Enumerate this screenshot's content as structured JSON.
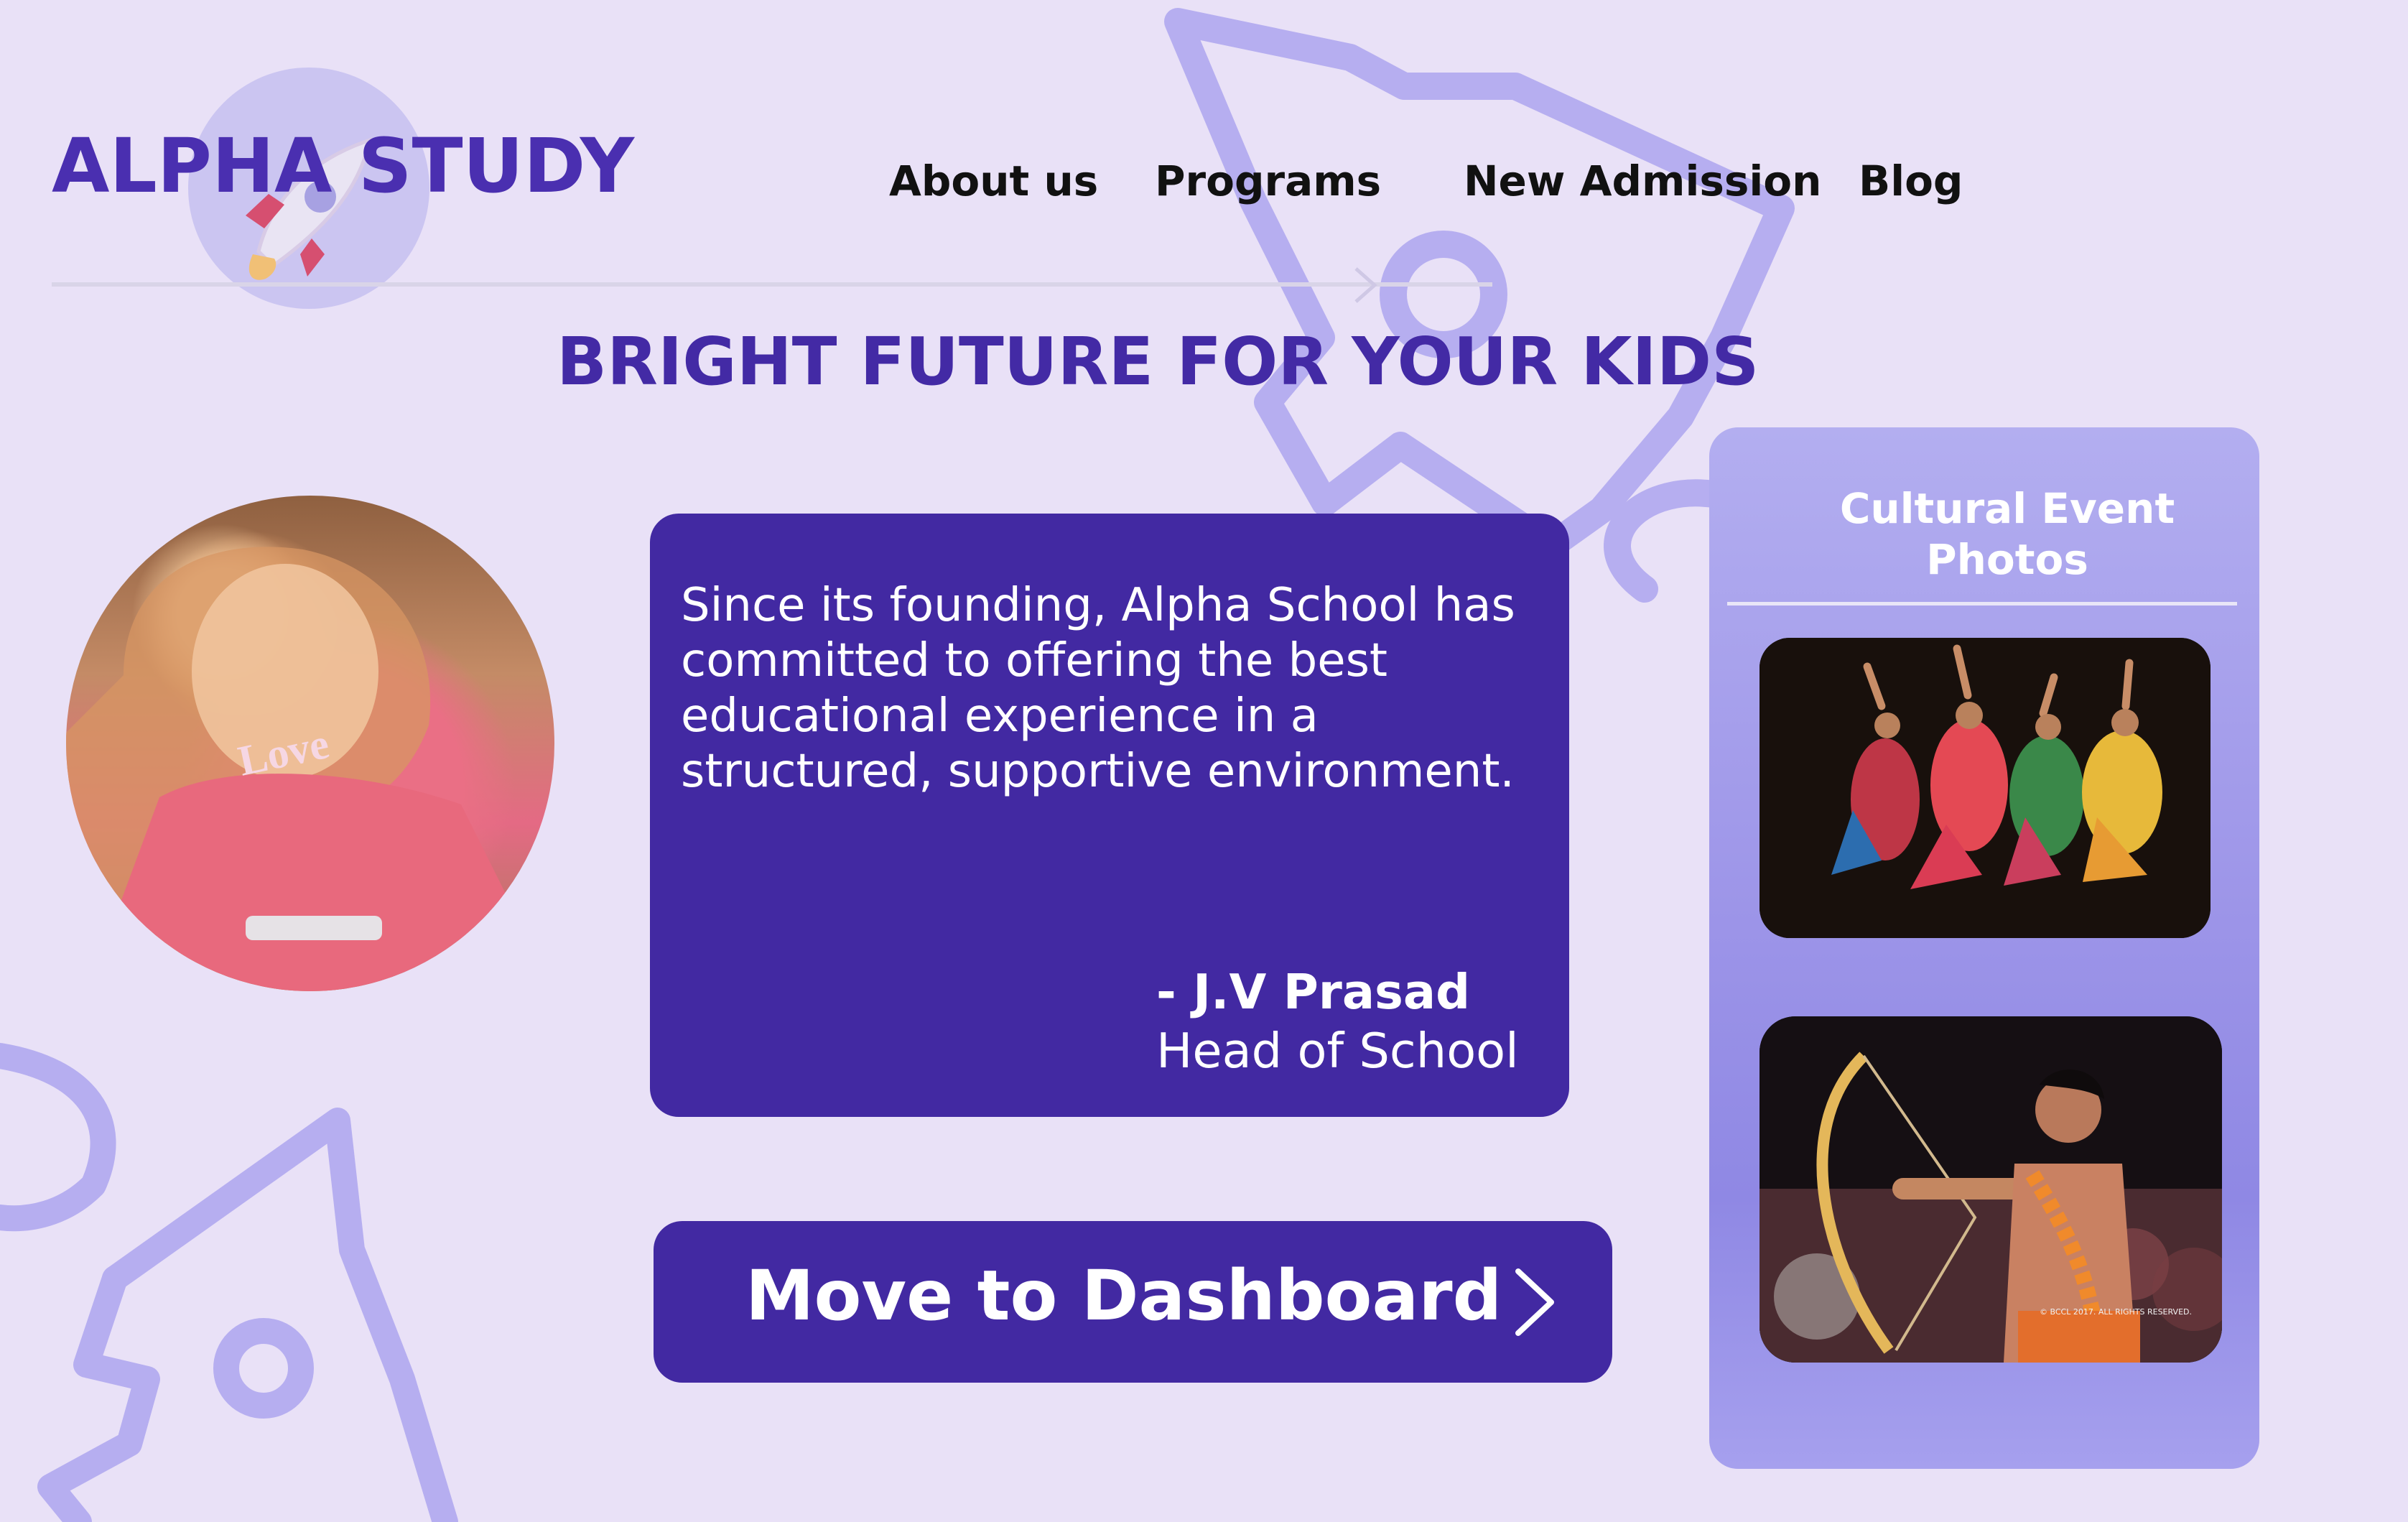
{
  "brand": {
    "name": "ALPHA STUDY"
  },
  "nav": {
    "items": [
      {
        "label": "About us"
      },
      {
        "label": "Programs"
      },
      {
        "label": "New Admission"
      },
      {
        "label": "Blog"
      }
    ]
  },
  "hero": {
    "headline": "BRIGHT FUTURE FOR YOUR KIDS"
  },
  "quote": {
    "text": "Since its founding, Alpha School has committed to offering the best educational  experience in a structured, supportive environment.",
    "author_name": "-  J.V Prasad",
    "author_title": "Head of School"
  },
  "dashboard_button": {
    "label": "Move to Dashboard",
    "icon": "chevron-right-icon"
  },
  "gallery": {
    "title": "Cultural Event Photos"
  },
  "colors": {
    "background": "#e9e1f7",
    "primary": "#4229a2",
    "panel": "#9c94e8"
  }
}
